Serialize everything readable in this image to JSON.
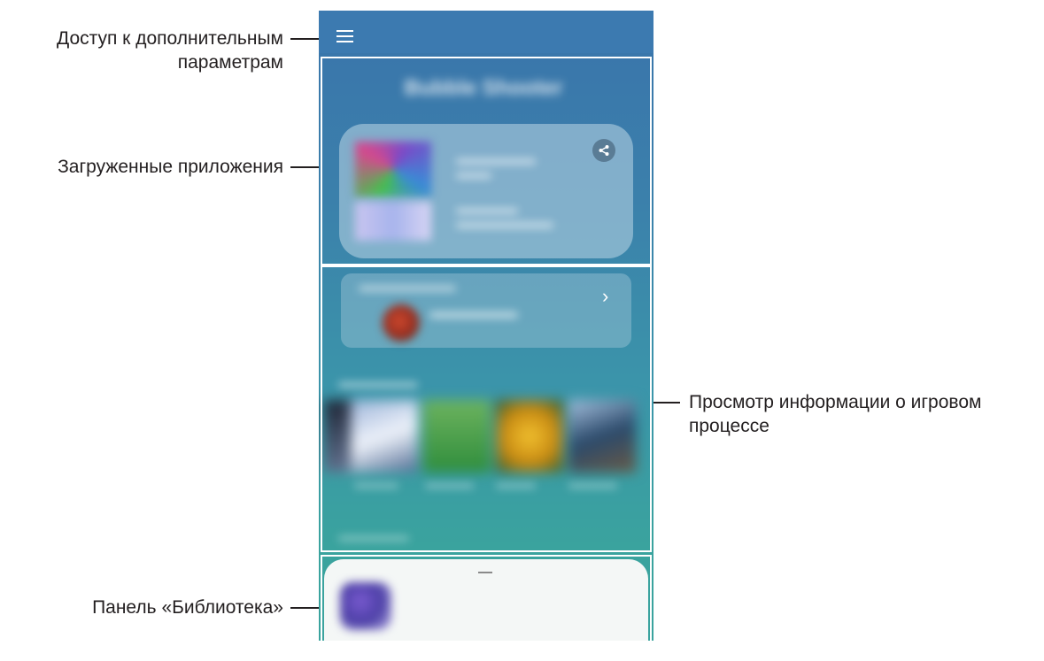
{
  "callouts": {
    "more_options": "Доступ к дополнительным параметрам",
    "more_options_line1": "Доступ к дополнительным",
    "more_options_line2": "параметрам",
    "downloaded_apps": "Загруженные приложения",
    "gameplay_info_line1": "Просмотр информации о игровом",
    "gameplay_info_line2": "процессе",
    "library_panel": "Панель «Библиотека»"
  },
  "screen": {
    "menu_icon": "hamburger-menu-icon",
    "share_icon": "share-icon",
    "chevron_icon": "chevron-right-icon",
    "colors": {
      "gradient_top": "#3a74ab",
      "gradient_bottom": "#3aa39e",
      "frame": "#ffffff",
      "library_bg": "#f4f7f6"
    }
  }
}
